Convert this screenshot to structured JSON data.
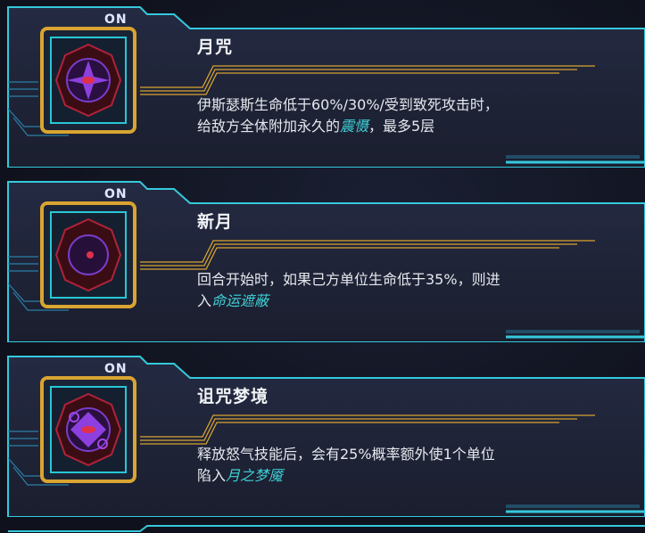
{
  "cards": [
    {
      "badge": "ON",
      "title": "月咒",
      "desc_plain_1": "伊斯瑟斯生命低于60%/30%/受到致死攻击时，",
      "desc_plain_2": "给敌方全体附加永久的",
      "desc_keyword": "震慑",
      "desc_plain_3": "，最多5层",
      "icon": "moon-curse-sigil-icon"
    },
    {
      "badge": "ON",
      "title": "新月",
      "desc_plain_1": "回合开始时，如果己方单位生命低于35%，则进",
      "desc_plain_2": "入",
      "desc_keyword": "命运遮蔽",
      "desc_plain_3": "",
      "icon": "new-moon-sigil-icon"
    },
    {
      "badge": "ON",
      "title": "诅咒梦境",
      "desc_plain_1": "释放怒气技能后，会有25%概率额外使1个单位",
      "desc_plain_2": "陷入",
      "desc_keyword": "月之梦魇",
      "desc_plain_3": "",
      "icon": "cursed-dream-sigil-icon"
    }
  ],
  "colors": {
    "frame_cyan": "#3ad4e6",
    "keyword": "#3fd1d6",
    "gold": "#d9a431",
    "panel": "#1d2236"
  }
}
